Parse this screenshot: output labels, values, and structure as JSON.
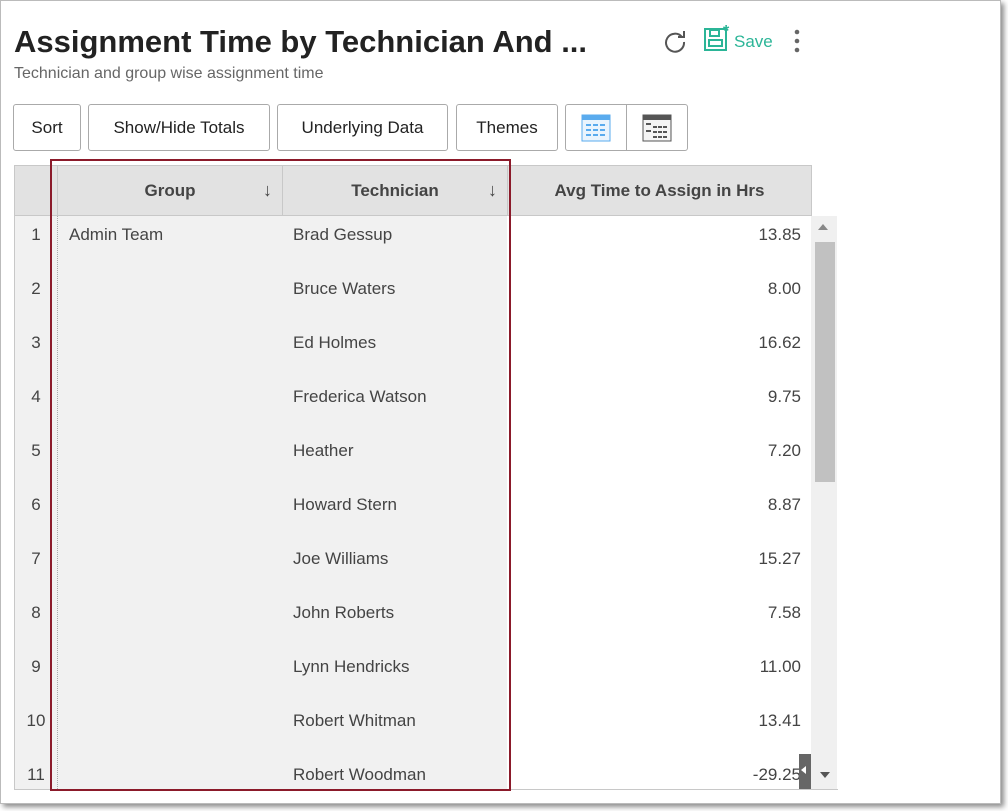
{
  "header": {
    "title": "Assignment Time by Technician And ...",
    "subtitle": "Technician and group wise assignment time",
    "save_label": "Save"
  },
  "toolbar": {
    "sort": "Sort",
    "totals": "Show/Hide Totals",
    "underlying": "Underlying Data",
    "themes": "Themes"
  },
  "colors": {
    "accent": "#2bb597",
    "selection": "#8b1a2a"
  },
  "table": {
    "columns": [
      "Group",
      "Technician",
      "Avg Time to Assign in Hrs"
    ],
    "sort_icon": "↓",
    "rows": [
      {
        "n": "1",
        "group": "Admin Team",
        "tech": "Brad Gessup",
        "avg": "13.85"
      },
      {
        "n": "2",
        "group": "",
        "tech": "Bruce Waters",
        "avg": "8.00"
      },
      {
        "n": "3",
        "group": "",
        "tech": "Ed Holmes",
        "avg": "16.62"
      },
      {
        "n": "4",
        "group": "",
        "tech": "Frederica Watson",
        "avg": "9.75"
      },
      {
        "n": "5",
        "group": "",
        "tech": "Heather",
        "avg": "7.20"
      },
      {
        "n": "6",
        "group": "",
        "tech": "Howard Stern",
        "avg": "8.87"
      },
      {
        "n": "7",
        "group": "",
        "tech": "Joe Williams",
        "avg": "15.27"
      },
      {
        "n": "8",
        "group": "",
        "tech": "John Roberts",
        "avg": "7.58"
      },
      {
        "n": "9",
        "group": "",
        "tech": "Lynn Hendricks",
        "avg": "11.00"
      },
      {
        "n": "10",
        "group": "",
        "tech": "Robert Whitman",
        "avg": "13.41"
      },
      {
        "n": "11",
        "group": "",
        "tech": "Robert Woodman",
        "avg": "-29.25"
      }
    ]
  }
}
